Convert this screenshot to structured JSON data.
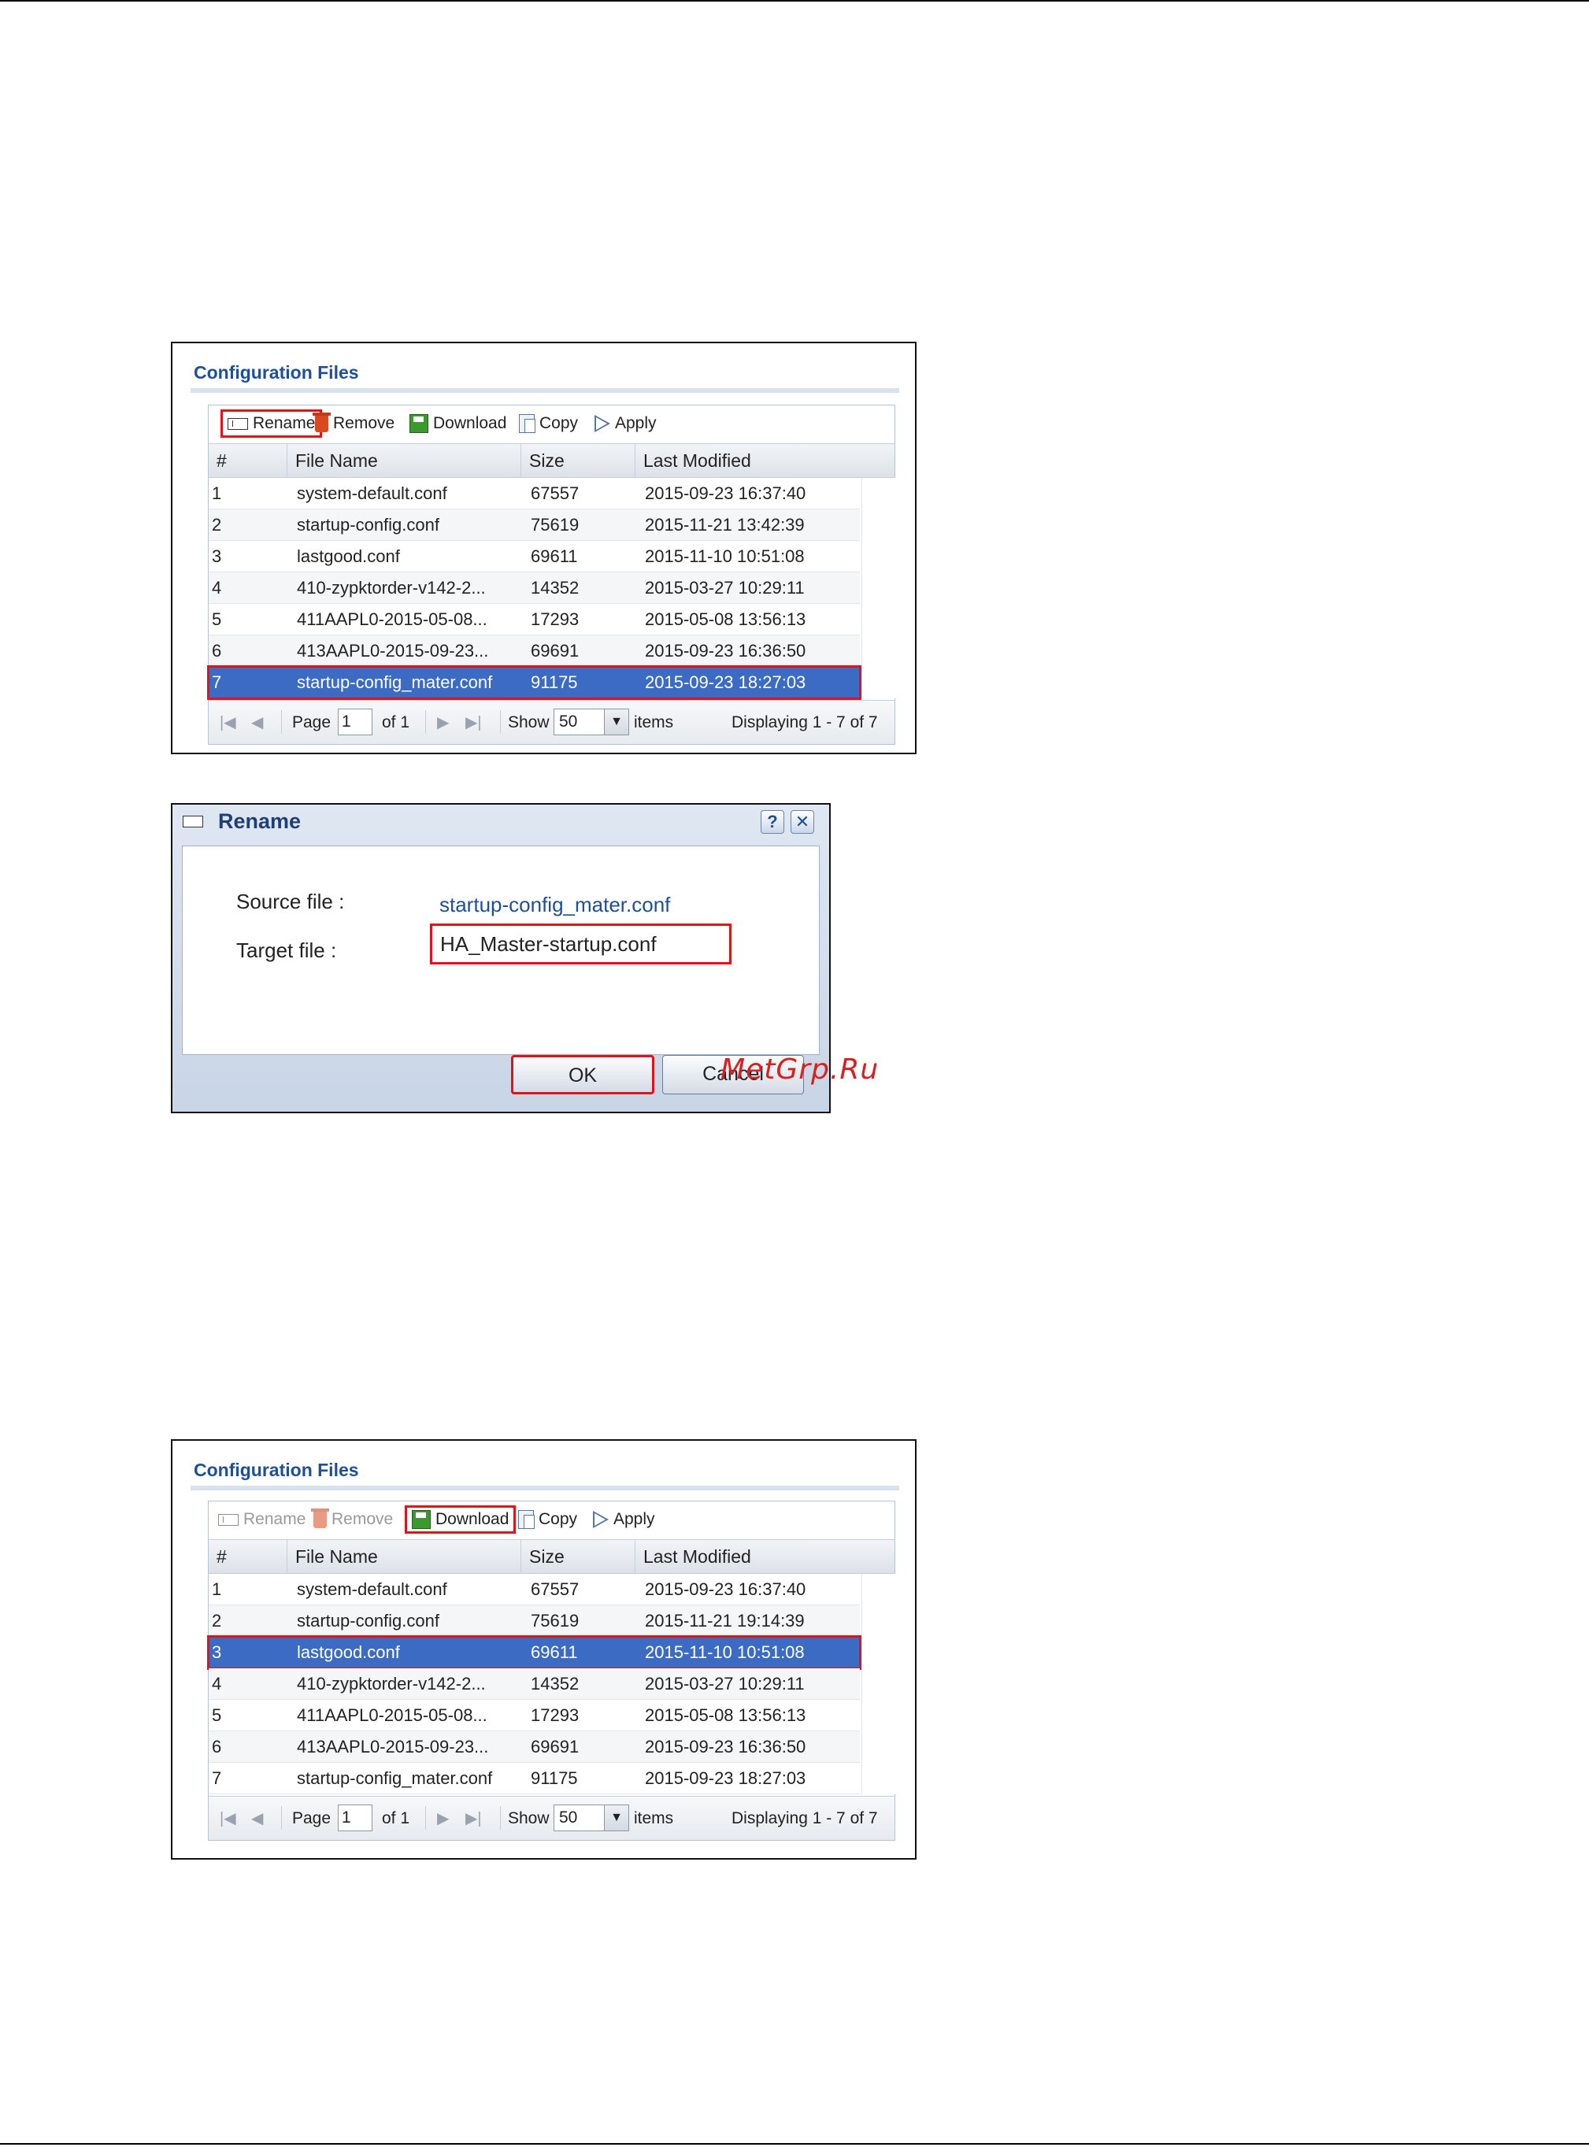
{
  "panel1": {
    "title": "Configuration Files",
    "toolbar": {
      "rename": "Rename",
      "remove": "Remove",
      "download": "Download",
      "copy": "Copy",
      "apply": "Apply"
    },
    "columns": [
      "#",
      "File Name",
      "Size",
      "Last Modified"
    ],
    "rows": [
      {
        "n": "1",
        "file": "system-default.conf",
        "size": "67557",
        "date": "2015-09-23 16:37:40"
      },
      {
        "n": "2",
        "file": "startup-config.conf",
        "size": "75619",
        "date": "2015-11-21 13:42:39"
      },
      {
        "n": "3",
        "file": "lastgood.conf",
        "size": "69611",
        "date": "2015-11-10 10:51:08"
      },
      {
        "n": "4",
        "file": "410-zypktorder-v142-2...",
        "size": "14352",
        "date": "2015-03-27 10:29:11"
      },
      {
        "n": "5",
        "file": "411AAPL0-2015-05-08...",
        "size": "17293",
        "date": "2015-05-08 13:56:13"
      },
      {
        "n": "6",
        "file": "413AAPL0-2015-09-23...",
        "size": "69691",
        "date": "2015-09-23 16:36:50"
      },
      {
        "n": "7",
        "file": "startup-config_mater.conf",
        "size": "91175",
        "date": "2015-09-23 18:27:03"
      }
    ],
    "pager": {
      "page_label": "Page",
      "page_value": "1",
      "of_label": "of 1",
      "show_label": "Show",
      "show_value": "50",
      "items_label": "items",
      "displaying": "Displaying 1 - 7 of 7"
    }
  },
  "dialog": {
    "title": "Rename",
    "help": "?",
    "close": "✕",
    "source_label": "Source file :",
    "source_value": "startup-config_mater.conf",
    "target_label": "Target file :",
    "target_value": "HA_Master-startup.conf",
    "ok": "OK",
    "cancel": "Cancel"
  },
  "watermark": "MetGrp.Ru",
  "panel2": {
    "title": "Configuration Files",
    "toolbar": {
      "rename": "Rename",
      "remove": "Remove",
      "download": "Download",
      "copy": "Copy",
      "apply": "Apply"
    },
    "columns": [
      "#",
      "File Name",
      "Size",
      "Last Modified"
    ],
    "rows": [
      {
        "n": "1",
        "file": "system-default.conf",
        "size": "67557",
        "date": "2015-09-23 16:37:40"
      },
      {
        "n": "2",
        "file": "startup-config.conf",
        "size": "75619",
        "date": "2015-11-21 19:14:39"
      },
      {
        "n": "3",
        "file": "lastgood.conf",
        "size": "69611",
        "date": "2015-11-10 10:51:08"
      },
      {
        "n": "4",
        "file": "410-zypktorder-v142-2...",
        "size": "14352",
        "date": "2015-03-27 10:29:11"
      },
      {
        "n": "5",
        "file": "411AAPL0-2015-05-08...",
        "size": "17293",
        "date": "2015-05-08 13:56:13"
      },
      {
        "n": "6",
        "file": "413AAPL0-2015-09-23...",
        "size": "69691",
        "date": "2015-09-23 16:36:50"
      },
      {
        "n": "7",
        "file": "startup-config_mater.conf",
        "size": "91175",
        "date": "2015-09-23 18:27:03"
      }
    ],
    "pager": {
      "page_label": "Page",
      "page_value": "1",
      "of_label": "of 1",
      "show_label": "Show",
      "show_value": "50",
      "items_label": "items",
      "displaying": "Displaying 1 - 7 of 7"
    }
  },
  "colors": {
    "accent": "#1f4f96",
    "selected_row": "#3c6bc4",
    "highlight": "#e0121a"
  }
}
